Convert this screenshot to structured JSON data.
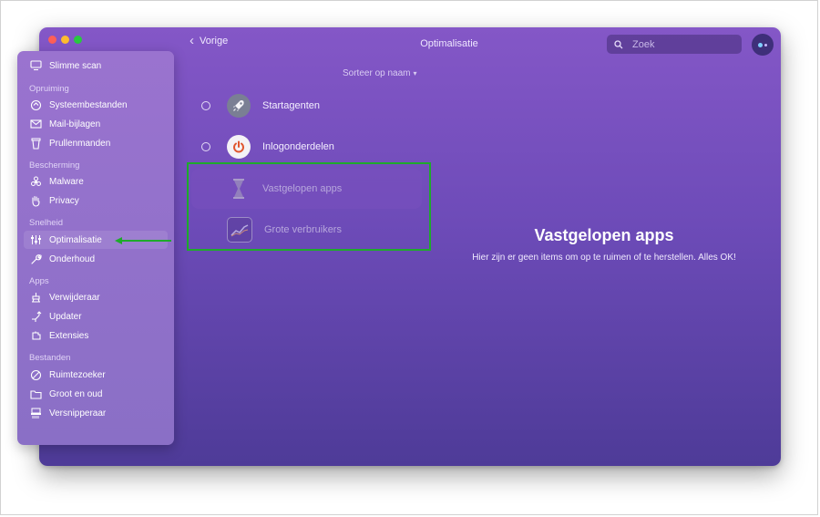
{
  "window": {
    "title": "Optimalisatie",
    "back_label": "Vorige",
    "search_placeholder": "Zoek",
    "sort_label": "Sorteer op naam"
  },
  "sidebar": {
    "top_item": "Slimme scan",
    "sections": [
      {
        "title": "Opruiming",
        "items": [
          "Systeembestanden",
          "Mail-bijlagen",
          "Prullenmanden"
        ]
      },
      {
        "title": "Bescherming",
        "items": [
          "Malware",
          "Privacy"
        ]
      },
      {
        "title": "Snelheid",
        "items": [
          "Optimalisatie",
          "Onderhoud"
        ]
      },
      {
        "title": "Apps",
        "items": [
          "Verwijderaar",
          "Updater",
          "Extensies"
        ]
      },
      {
        "title": "Bestanden",
        "items": [
          "Ruimtezoeker",
          "Groot en oud",
          "Versnipperaar"
        ]
      }
    ],
    "active_item": "Optimalisatie"
  },
  "list": [
    {
      "label": "Startagenten",
      "icon": "rocket-icon"
    },
    {
      "label": "Inlogonderdelen",
      "icon": "power-icon"
    },
    {
      "label": "Vastgelopen apps",
      "icon": "hourglass-icon"
    },
    {
      "label": "Grote verbruikers",
      "icon": "chart-icon"
    }
  ],
  "detail": {
    "title": "Vastgelopen apps",
    "subtitle": "Hier zijn er geen items om op te ruimen of te herstellen. Alles OK!"
  },
  "colors": {
    "annotation_green": "#1faa2b",
    "accent_purple": "#6d4bb8"
  }
}
